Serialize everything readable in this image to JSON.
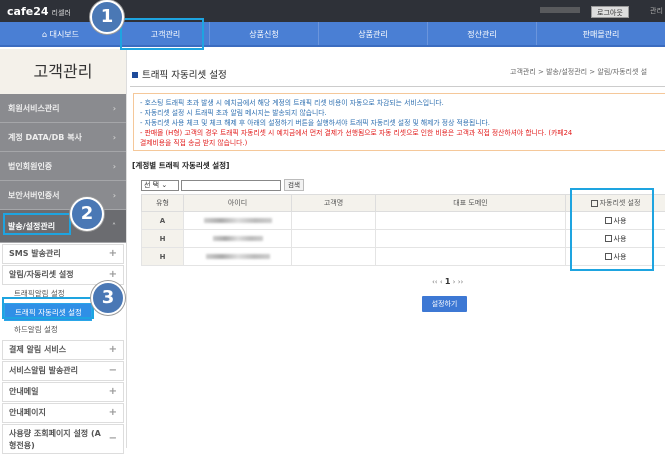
{
  "header": {
    "logo": "cafe24",
    "logo_sub": "리셀러",
    "logout": "로그아웃",
    "admin": "관리"
  },
  "nav": [
    "대시보드",
    "고객관리",
    "상품신청",
    "상품관리",
    "정산관리",
    "판매몰관리"
  ],
  "sidebar": {
    "title": "고객관리",
    "gray_items": [
      "회원서비스관리",
      "계정 DATA/DB 복사",
      "법인회원인증",
      "보안서버인증서"
    ],
    "active": "발송/설정관리",
    "sms": "SMS 발송관리",
    "alarm": "알림/자동리셋 설정",
    "subs": [
      "트래픽알림 설정",
      "트래픽 자동리셋 설정",
      "하드알림 설정"
    ],
    "rest": [
      {
        "label": "결제 알림 서비스",
        "sign": "+"
      },
      {
        "label": "서비스알림 발송관리",
        "sign": "−"
      },
      {
        "label": "안내메일",
        "sign": "+"
      },
      {
        "label": "안내페이지",
        "sign": "+"
      },
      {
        "label": "사용량 조회페이지 설정 (A형전용)",
        "sign": "−"
      }
    ]
  },
  "main": {
    "title": "트래픽 자동리셋 설정",
    "breadcrumb": "고객관리 > 발송/설정관리 > 알림/자동리셋 설",
    "notice": [
      "- 호스팅 트래픽 초과 발생 시 예치금에서 해당 계정의 트래픽 리셋 비용이 자동으로 차감되는 서비스입니다.",
      "- 자동리셋 설정 시 트래픽 초과 알림 메시지는 발송되지 않습니다.",
      "- 자동리셋 사용 체크 및 체크 해제 후 아래의 설정하기 버튼을 실행하셔야 트래픽 자동리셋 설정 및 해제가 정상 적용됩니다.",
      "- 판매몰 (H형) 고객의 경우 트래픽 자동리셋 시 예치금에서 먼저 결제가 선행됨으로 자동 리셋으로 인한 비용은 고객과 직접 정산하셔야 합니다. (카페24",
      "결제비용을 직접 송금 받지 않습니다.)"
    ],
    "section": "[계정별 트래픽 자동리셋 설정]",
    "select": "선 택",
    "search_btn": "검색",
    "columns": [
      "유형",
      "아이디",
      "고객명",
      "대표 도메인",
      "자동리셋 설정"
    ],
    "rows": [
      {
        "type": "A",
        "use": "사용"
      },
      {
        "type": "H",
        "use": "사용"
      },
      {
        "type": "H",
        "use": "사용"
      }
    ],
    "pager": {
      "prev": "‹‹ ‹",
      "page": "1",
      "next": "› ››"
    },
    "apply": "설정하기"
  },
  "annotations": [
    "1",
    "2",
    "3"
  ],
  "colors": {
    "nav": "#4a7fd4",
    "highlight": "#1ea4e0",
    "callout": "#4a78b5",
    "warning": "#e21b1b"
  }
}
